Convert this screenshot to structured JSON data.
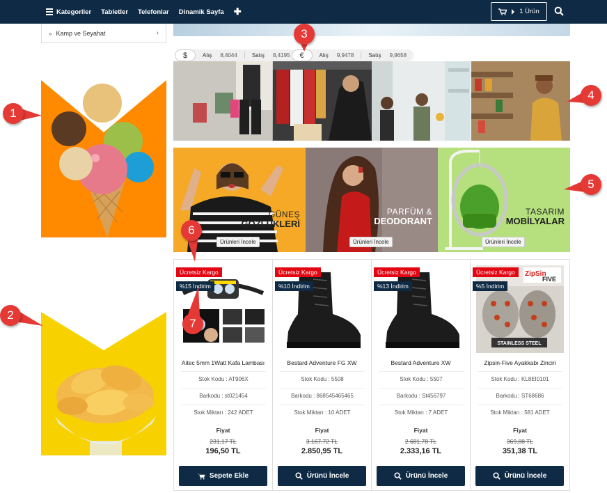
{
  "nav": {
    "categories_label": "Kategoriler",
    "tablets_label": "Tabletler",
    "phones_label": "Telefonlar",
    "dynamic_page_label": "Dinamik Sayfa",
    "cart_label": "1 Ürün"
  },
  "sidebar": {
    "category_item": "Kamp ve Seyahat"
  },
  "currency": {
    "usd": {
      "symbol": "$",
      "buy_label": "Alış",
      "buy": "8,4044",
      "sell_label": "Satış",
      "sell": "8,4195"
    },
    "eur": {
      "symbol": "€",
      "buy_label": "Alış",
      "buy": "9,9478",
      "sell_label": "Satış",
      "sell": "9,9658"
    }
  },
  "promos": [
    {
      "line1": "GÜNEŞ",
      "line2": "GÖZLÜKLERİ",
      "button": "Ürünleri İncele"
    },
    {
      "line1": "PARFÜM &",
      "line2": "DEODORANT",
      "button": "Ürünleri İncele"
    },
    {
      "line1": "TASARIM",
      "line2": "MOBİLYALAR",
      "button": "Ürünleri İncele"
    }
  ],
  "products": [
    {
      "cargo": "Ücretsiz Kargo",
      "discount": "%15 İndirim",
      "name": "Aitec 5mm 1Watt Kafa Lambası",
      "stock_code": "Stok Kodu : AT906X",
      "barcode": "Barkodu : st021454",
      "stock_qty": "Stok Miktarı : 242 ADET",
      "price_label": "Fiyat",
      "old_price": "231,17 TL",
      "new_price": "196,50 TL",
      "button": "Sepete Ekle"
    },
    {
      "cargo": "Ücretsiz Kargo",
      "discount": "%10 İndirim",
      "name": "Bestard Adventure FG XW",
      "stock_code": "Stok Kodu : 5508",
      "barcode": "Barkodu : 868545465465",
      "stock_qty": "Stok Miktarı : 10 ADET",
      "price_label": "Fiyat",
      "old_price": "3.167,72 TL",
      "new_price": "2.850,95 TL",
      "button": "Ürünü İncele"
    },
    {
      "cargo": "Ücretsiz Kargo",
      "discount": "%13 İndirim",
      "name": "Bestard Adventure XW",
      "stock_code": "Stok Kodu : 5507",
      "barcode": "Barkodu : St456797",
      "stock_qty": "Stok Miktarı : 7 ADET",
      "price_label": "Fiyat",
      "old_price": "2.681,78 TL",
      "new_price": "2.333,16 TL",
      "button": "Ürünü İncele"
    },
    {
      "cargo": "Ücretsiz Kargo",
      "discount": "%5 İndirim",
      "name": "Zipsin-Five Ayakkabı Zinciri",
      "stock_code": "Stok Kodu : KL8EI0101",
      "barcode": "Barkodu : ST68686",
      "stock_qty": "Stok Miktarı : 581 ADET",
      "price_label": "Fiyat",
      "old_price": "369,88 TL",
      "new_price": "351,38 TL",
      "button": "Ürünü İncele"
    }
  ],
  "product_image_text": {
    "zipsin_logo": "ZipSin",
    "zipsin_five": "FIVE",
    "stainless": "STAINLESS STEEL"
  },
  "callouts": [
    "1",
    "2",
    "3",
    "4",
    "5",
    "6",
    "7"
  ],
  "colors": {
    "nav_bg": "#0f2a44",
    "cargo_badge": "#e30613",
    "discount_badge": "#0f2a44",
    "callout": "#e53935",
    "banner_orange": "#ff8a00",
    "banner_yellow": "#f7d200"
  }
}
